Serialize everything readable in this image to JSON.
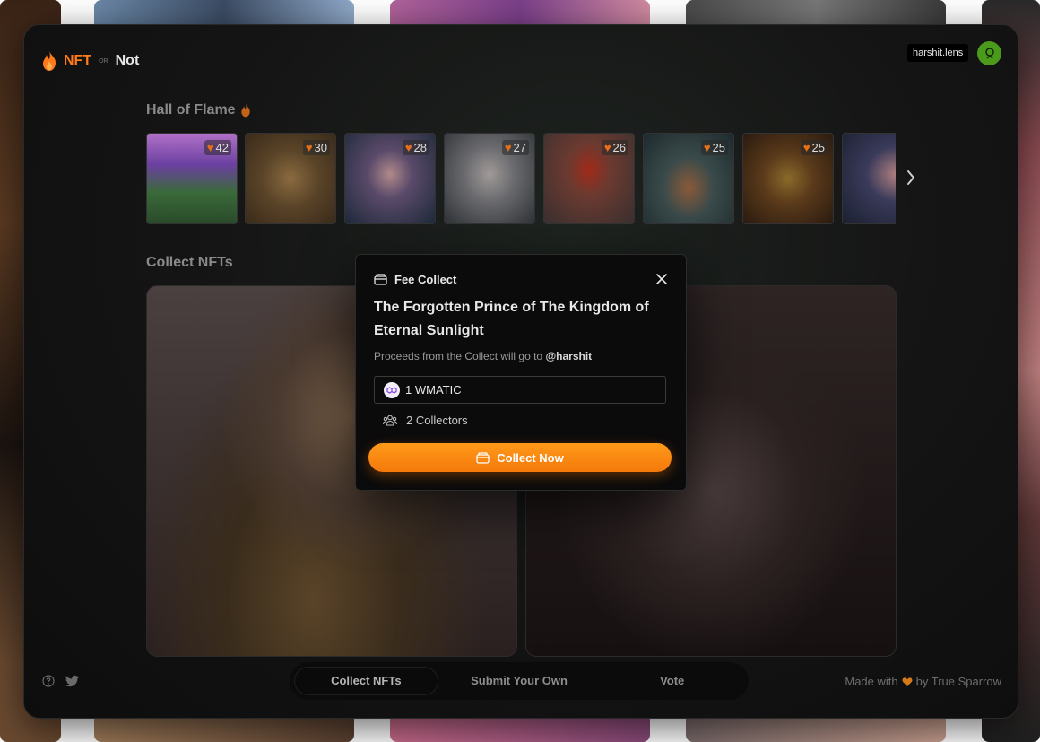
{
  "app": {
    "logo_nft": "NFT",
    "logo_or": "OR",
    "logo_not": "Not",
    "username": "harshit.lens"
  },
  "hall_of_flame": {
    "title": "Hall of Flame",
    "items": [
      {
        "count": "42"
      },
      {
        "count": "30"
      },
      {
        "count": "28"
      },
      {
        "count": "27"
      },
      {
        "count": "26"
      },
      {
        "count": "25"
      },
      {
        "count": "25"
      },
      {
        "count": ""
      }
    ]
  },
  "collect": {
    "title": "Collect NFTs"
  },
  "modal": {
    "header": "Fee Collect",
    "nft_title": "The Forgotten Prince of The Kingdom of Eternal Sunlight",
    "proceeds_prefix": "Proceeds from the Collect will go to",
    "proceeds_handle": "@harshit",
    "amount": "1 WMATIC",
    "collectors": "2 Collectors",
    "button": "Collect Now"
  },
  "nav": {
    "items": [
      "Collect NFTs",
      "Submit Your Own",
      "Vote"
    ],
    "active": "Collect NFTs"
  },
  "footer": {
    "made_with": "Made with",
    "by": "by True Sparrow"
  },
  "colors": {
    "accent": "#ff8a0f",
    "brand_nft": "#ff7a1a",
    "avatar": "#4c9a1c"
  }
}
